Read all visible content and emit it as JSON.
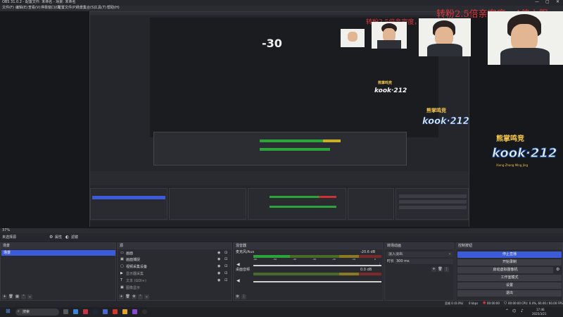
{
  "window": {
    "title": "OBS 31.0.2 - 配置文件: 未命名 - 场景: 未命名"
  },
  "menu": [
    "文件(F)",
    "编辑(E)",
    "查看(V)",
    "停靠窗口(D)",
    "配置文件(P)",
    "场景集合(S)",
    "工具(T)",
    "帮助(H)"
  ],
  "overlay": {
    "banner_top": "转粉2.5倍亲密度，4倍上限",
    "banner_mid": "转粉2.5倍亲密度，4倍上限",
    "countdown": "-30",
    "logo_top": "熊掌鸣竞",
    "logo_main": "kook·212",
    "logo_sub": "Xiong Zhang Ming Jing"
  },
  "toolbar": {
    "fps_text": "37%",
    "source_label": "未选择源",
    "properties_label": "属性",
    "filters_label": "滤镜"
  },
  "scenes": {
    "header": "场景",
    "items": [
      "场景"
    ]
  },
  "sources": {
    "header": "源",
    "items": [
      "画面",
      "画面捕捉",
      "视频采集设备",
      "显示器采集",
      "文本 (GDI+)",
      "图像显示"
    ]
  },
  "mixer": {
    "header": "混音器",
    "channels": [
      {
        "name": "麦克风/Aux",
        "db": "-20.6 dB"
      },
      {
        "name": "桌面音频",
        "db": "0.0 dB"
      }
    ],
    "ticks": [
      "-60",
      "-55",
      "-50",
      "-45",
      "-40",
      "-35",
      "-30",
      "-25",
      "-20",
      "-15",
      "-10",
      "-5",
      "0"
    ]
  },
  "transitions": {
    "header": "转场动画",
    "selected": "淡入淡出",
    "duration_label": "时长",
    "duration_value": "300 ms"
  },
  "controls": {
    "header": "控制按钮",
    "buttons": [
      "停止直播",
      "开始录制",
      "启动虚拟摄像机",
      "工作室模式",
      "设置",
      "退出"
    ]
  },
  "statusbar": {
    "dropped": "丢帧 0 (0.0%)",
    "bitrate": "0 kbps",
    "live": "00:00:00",
    "rec": "00:00:00",
    "cpu": "CPU: 0.4%, 60.00 / 60.00 FPS"
  },
  "taskbar": {
    "search_placeholder": "搜索",
    "time": "17:46",
    "date": "2025/3/21"
  },
  "colors": {
    "accent": "#3b5bd9",
    "meter_green": "#2fa33b",
    "meter_yellow": "#c9b026",
    "meter_red": "#c83434"
  }
}
